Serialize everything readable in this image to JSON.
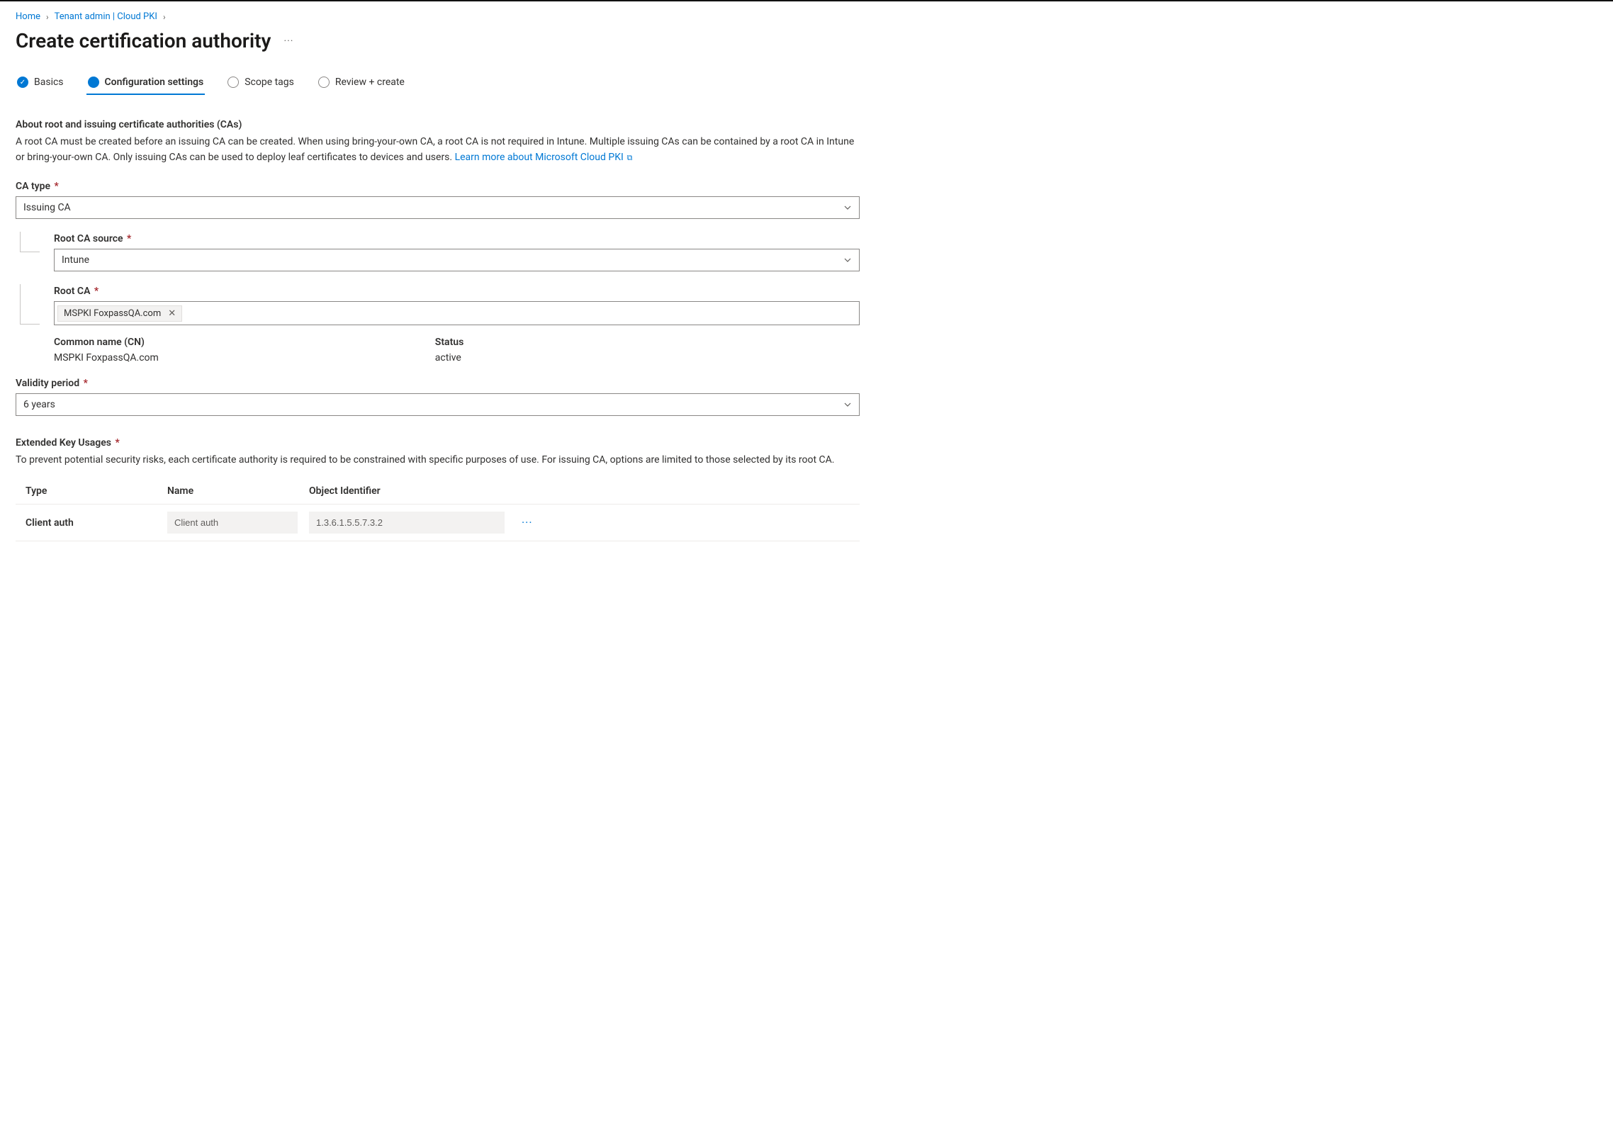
{
  "breadcrumb": {
    "home": "Home",
    "tenant": "Tenant admin | Cloud PKI"
  },
  "title": "Create certification authority",
  "tabs": {
    "basics": "Basics",
    "config": "Configuration settings",
    "scope": "Scope tags",
    "review": "Review + create"
  },
  "about": {
    "heading": "About root and issuing certificate authorities (CAs)",
    "body": "A root CA must be created before an issuing CA can be created. When using bring-your-own CA, a root CA is not required in Intune. Multiple issuing CAs can be contained by a root CA in Intune or bring-your-own CA. Only issuing CAs can be used to deploy leaf certificates to devices and users. ",
    "link": "Learn more about Microsoft Cloud PKI"
  },
  "fields": {
    "caTypeLabel": "CA type",
    "caTypeValue": "Issuing CA",
    "rootSourceLabel": "Root CA source",
    "rootSourceValue": "Intune",
    "rootCaLabel": "Root CA",
    "rootCaChip": "MSPKI FoxpassQA.com",
    "cnLabel": "Common name (CN)",
    "cnValue": "MSPKI FoxpassQA.com",
    "statusLabel": "Status",
    "statusValue": "active",
    "validityLabel": "Validity period",
    "validityValue": "6 years"
  },
  "eku": {
    "heading": "Extended Key Usages",
    "desc": "To prevent potential security risks, each certificate authority is required to be constrained with specific purposes of use. For issuing CA, options are limited to those selected by its root CA.",
    "cols": {
      "type": "Type",
      "name": "Name",
      "oid": "Object Identifier"
    },
    "row": {
      "type": "Client auth",
      "name": "Client auth",
      "oid": "1.3.6.1.5.5.7.3.2"
    }
  }
}
